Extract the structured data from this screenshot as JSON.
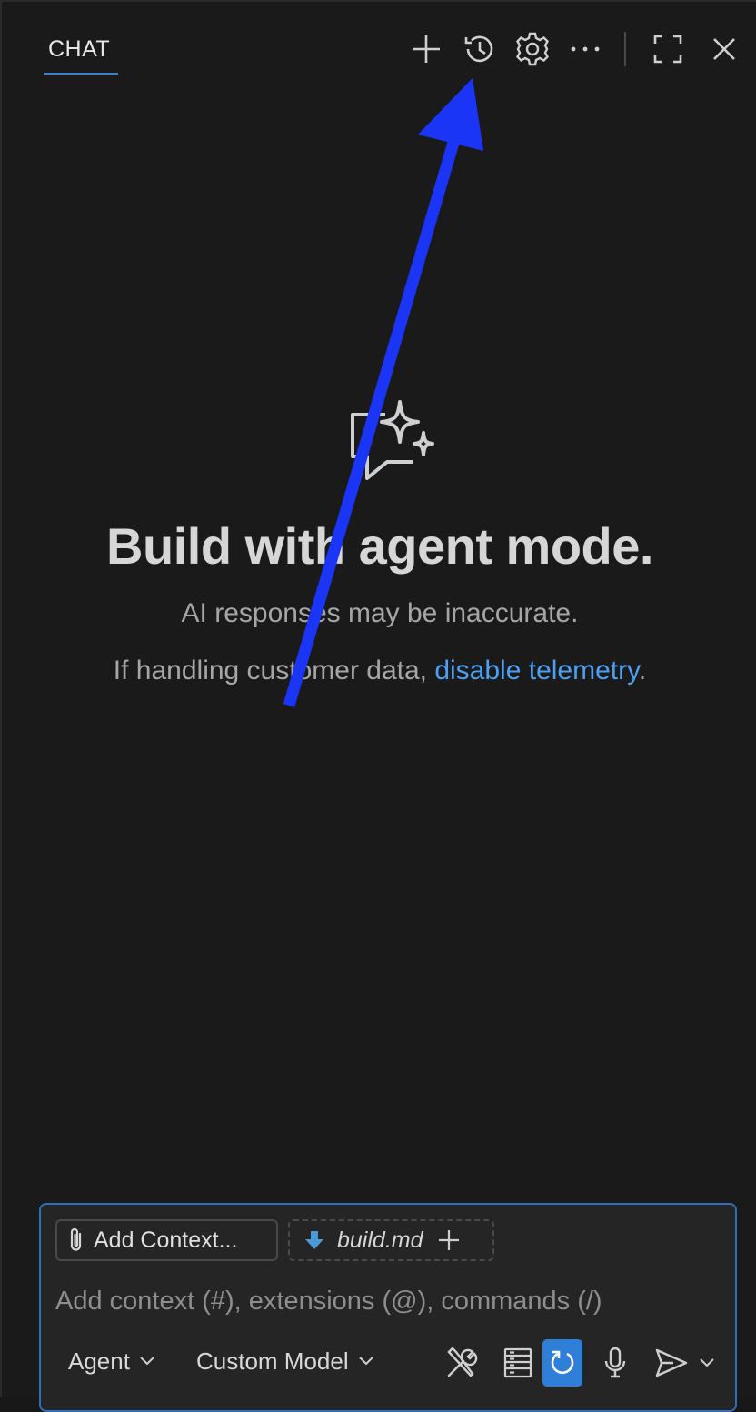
{
  "header": {
    "tab_label": "CHAT",
    "icons": [
      "plus-icon",
      "history-icon",
      "gear-icon",
      "more-icon",
      "maximize-icon",
      "close-icon"
    ]
  },
  "welcome": {
    "title": "Build with agent mode.",
    "disclaimer": "AI responses may be inaccurate.",
    "telemetry_prefix": "If handling customer data, ",
    "telemetry_link": "disable telemetry",
    "telemetry_suffix": "."
  },
  "input": {
    "add_context_label": "Add Context...",
    "attached_file": "build.md",
    "placeholder": "Add context (#), extensions (@), commands (/)",
    "mode": "Agent",
    "model": "Custom Model"
  },
  "colors": {
    "background": "#1a1a1a",
    "accent": "#2f7fd8",
    "link": "#4d9ff0",
    "annotation_arrow": "#1a35f5"
  }
}
